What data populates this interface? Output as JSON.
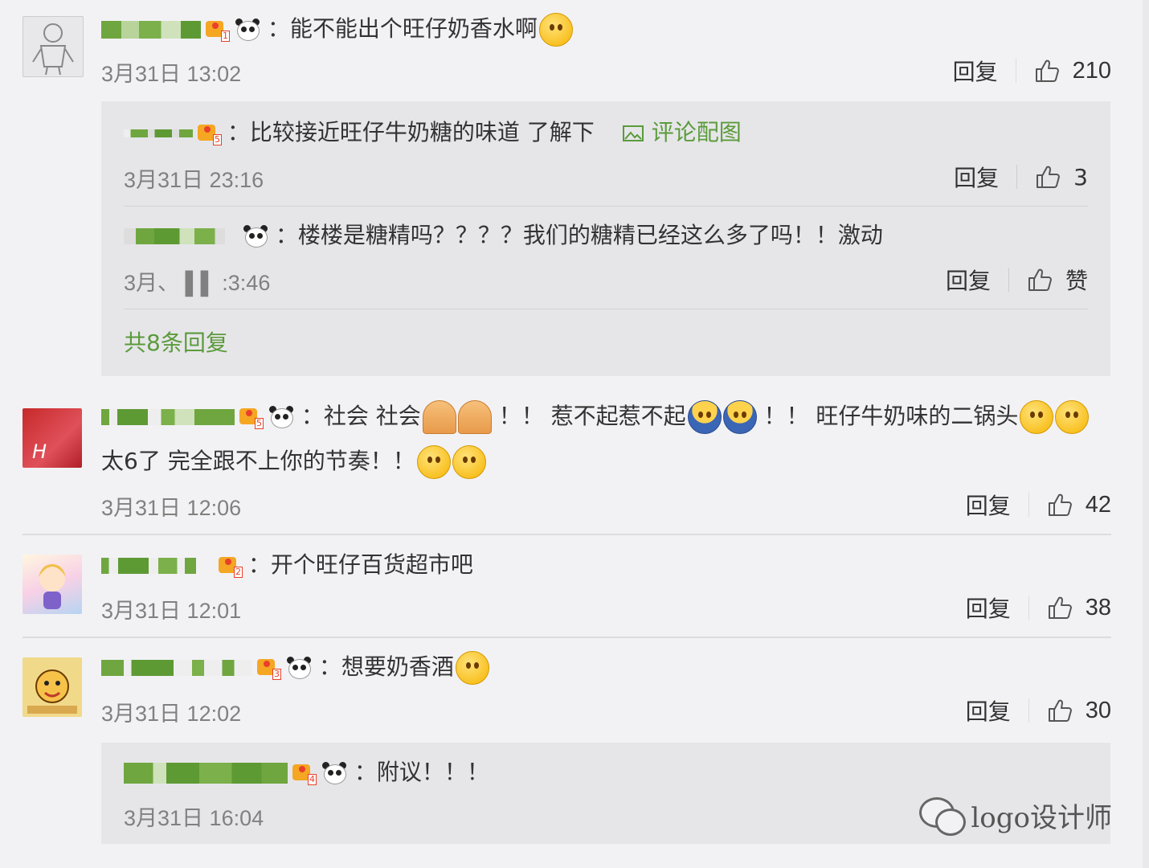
{
  "comments": [
    {
      "badge_level": "1",
      "text": "：能不能出个旺仔奶香水啊",
      "time": "3月31日 13:02",
      "reply_label": "回复",
      "likes": "210",
      "replies": [
        {
          "badge_level": "5",
          "text": "：比较接近旺仔牛奶糖的味道 了解下",
          "image_link": "评论配图",
          "time": "3月31日 23:16",
          "reply_label": "回复",
          "likes": "3"
        },
        {
          "text": "：楼楼是糖精吗？？？？我们的糖精已经这么多了吗！！激动",
          "time": "3月、 ▌▌ :3:46",
          "reply_label": "回复",
          "likes": "赞"
        }
      ],
      "more_replies": "共8条回复"
    },
    {
      "badge_level": "5",
      "text_a": "：社会 社会",
      "text_b": "！！ 惹不起惹不起",
      "text_c": "！！ 旺仔牛奶味的二锅头",
      "text_line2": "太6了 完全跟不上你的节奏！！",
      "time": "3月31日 12:06",
      "reply_label": "回复",
      "likes": "42"
    },
    {
      "badge_level": "2",
      "text": "：开个旺仔百货超市吧",
      "time": "3月31日 12:01",
      "reply_label": "回复",
      "likes": "38"
    },
    {
      "badge_level": "3",
      "text": "：想要奶香酒",
      "time": "3月31日 12:02",
      "reply_label": "回复",
      "likes": "30",
      "replies": [
        {
          "badge_level": "4",
          "text": "：附议！！！",
          "time": "3月31日 16:04"
        }
      ]
    }
  ],
  "watermark": "logo设计师",
  "colors": {
    "accent_green": "#5b9b3b",
    "meta_gray": "#808080",
    "background": "#f2f2f5",
    "reply_box": "#e6e6e9"
  }
}
